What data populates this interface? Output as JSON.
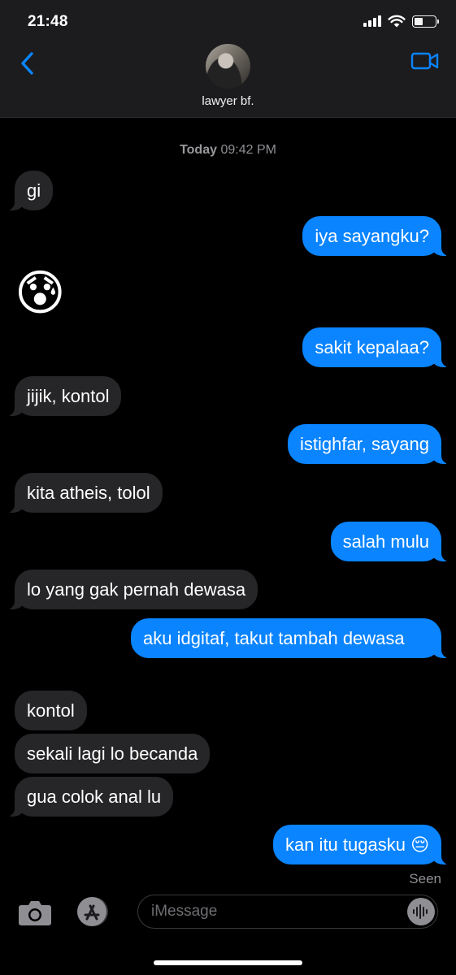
{
  "status_bar": {
    "time": "21:48",
    "battery_level": 0.45
  },
  "header": {
    "contact_name": "lawyer bf.",
    "back_icon": "chevron-left-icon",
    "video_icon": "video-camera-icon",
    "accent": "#0a84ff"
  },
  "conversation": {
    "timestamp_day": "Today",
    "timestamp_time": "09:42 PM",
    "messages": [
      {
        "dir": "in",
        "text": "gi"
      },
      {
        "dir": "out",
        "text": "iya sayangku?"
      },
      {
        "dir": "in",
        "text": "😰"
      },
      {
        "dir": "out",
        "text": "sakit kepalaa?"
      },
      {
        "dir": "in",
        "text": "jijik, kontol"
      },
      {
        "dir": "out",
        "text": "istighfar, sayang"
      },
      {
        "dir": "in",
        "text": "kita atheis, tolol"
      },
      {
        "dir": "out",
        "text": "salah mulu"
      },
      {
        "dir": "in",
        "text": "lo yang gak pernah dewasa"
      },
      {
        "dir": "out",
        "text": "aku idgitaf, takut tambah dewasa"
      },
      {
        "dir": "in",
        "text": "kontol"
      },
      {
        "dir": "in",
        "text": "sekali lagi lo becanda"
      },
      {
        "dir": "in",
        "text": "gua colok anal lu"
      },
      {
        "dir": "out",
        "text": "kan itu tugasku 😔"
      }
    ],
    "read_receipt": "Seen"
  },
  "composer": {
    "placeholder": "iMessage",
    "value": ""
  },
  "colors": {
    "incoming_bubble": "#262628",
    "outgoing_bubble": "#0a84ff",
    "background": "#000000"
  }
}
